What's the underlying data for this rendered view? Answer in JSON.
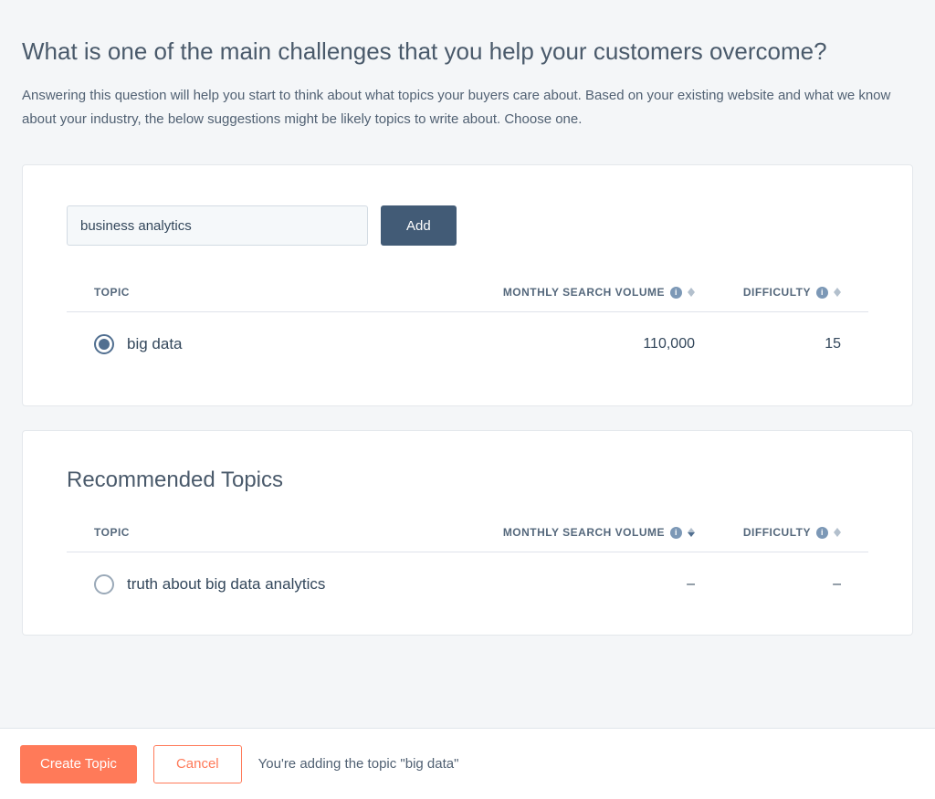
{
  "heading": "What is one of the main challenges that you help your customers overcome?",
  "subtext": "Answering this question will help you start to think about what topics your buyers care about. Based on your existing website and what we know about your industry, the below suggestions might be likely topics to write about. Choose one.",
  "input": {
    "value": "business analytics",
    "add_label": "Add"
  },
  "columns": {
    "topic": "TOPIC",
    "volume": "MONTHLY SEARCH VOLUME",
    "difficulty": "DIFFICULTY"
  },
  "added_topics": [
    {
      "name": "big data",
      "volume": "110,000",
      "difficulty": "15",
      "selected": true
    }
  ],
  "recommended": {
    "title": "Recommended Topics",
    "rows": [
      {
        "name": "truth about big data analytics",
        "volume": "–",
        "difficulty": "–",
        "selected": false
      }
    ]
  },
  "footer": {
    "create_label": "Create Topic",
    "cancel_label": "Cancel",
    "status": "You're adding the topic \"big data\""
  }
}
